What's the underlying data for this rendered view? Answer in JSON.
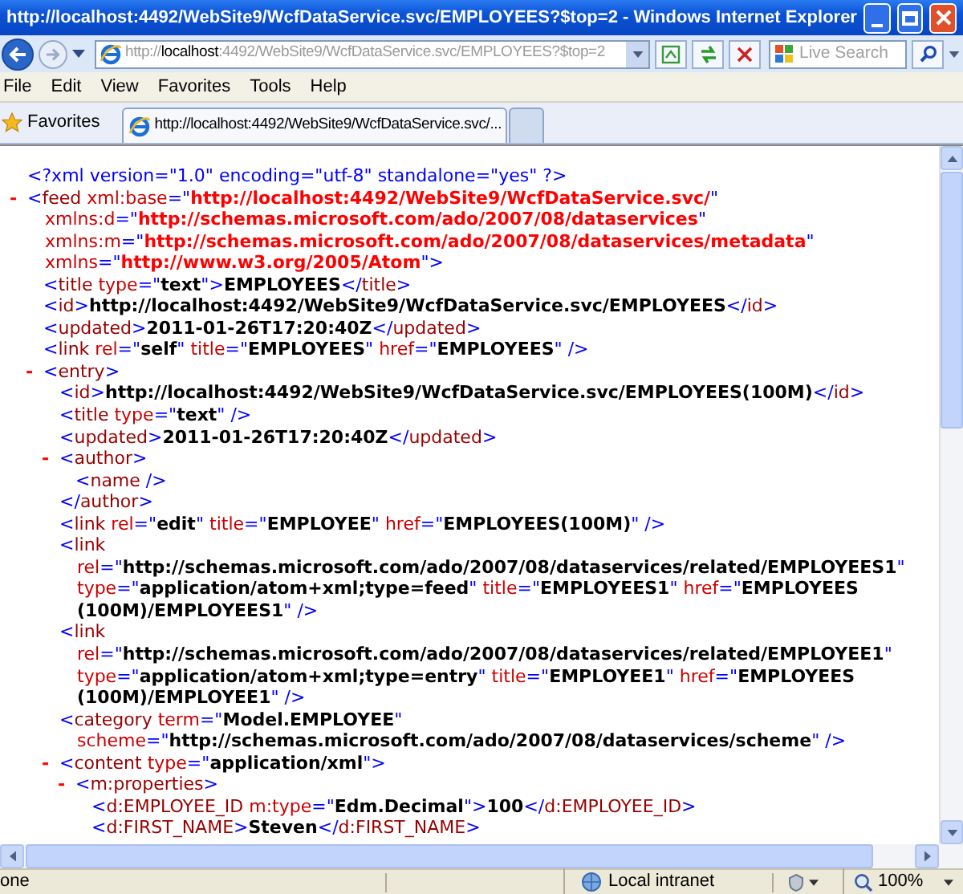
{
  "window": {
    "title": "http://localhost:4492/WebSite9/WcfDataService.svc/EMPLOYEES?$top=2 - Windows Internet Explorer"
  },
  "nav": {
    "address": {
      "scheme": "http://",
      "host": "localhost",
      "rest": ":4492/WebSite9/WcfDataService.svc/EMPLOYEES?$top=2"
    },
    "search": {
      "placeholder": "Live Search"
    }
  },
  "menu": [
    "File",
    "Edit",
    "View",
    "Favorites",
    "Tools",
    "Help"
  ],
  "favorites_bar": {
    "label": "Favorites",
    "tabs": [
      {
        "title": "http://localhost:4492/WebSite9/WcfDataService.svc/...",
        "selected": true
      }
    ]
  },
  "document": [
    {
      "lines": [
        [
          {
            "kind": "decl",
            "text": "<?xml version=\"1.0\" encoding=\"utf-8\" standalone=\"yes\" ?>"
          }
        ]
      ]
    },
    {
      "toggle": "-",
      "lines": [
        [
          {
            "kind": "punct",
            "text": "<"
          },
          {
            "kind": "tag",
            "text": "feed"
          },
          {
            "kind": "attr",
            "text": " xml:base"
          },
          {
            "kind": "punct",
            "text": "=\""
          },
          {
            "kind": "url",
            "text": "http://localhost:4492/WebSite9/WcfDataService.svc/"
          },
          {
            "kind": "punct",
            "text": "\""
          }
        ],
        [
          {
            "kind": "attr",
            "text": "xmlns:d"
          },
          {
            "kind": "punct",
            "text": "=\""
          },
          {
            "kind": "url",
            "text": "http://schemas.microsoft.com/ado/2007/08/dataservices"
          },
          {
            "kind": "punct",
            "text": "\""
          }
        ],
        [
          {
            "kind": "attr",
            "text": "xmlns:m"
          },
          {
            "kind": "punct",
            "text": "=\""
          },
          {
            "kind": "url",
            "text": "http://schemas.microsoft.com/ado/2007/08/dataservices/metadata"
          },
          {
            "kind": "punct",
            "text": "\""
          }
        ],
        [
          {
            "kind": "attr",
            "text": "xmlns"
          },
          {
            "kind": "punct",
            "text": "=\""
          },
          {
            "kind": "url",
            "text": "http://www.w3.org/2005/Atom"
          },
          {
            "kind": "punct",
            "text": "\">"
          }
        ]
      ],
      "children": [
        {
          "lines": [
            [
              {
                "kind": "punct",
                "text": "<"
              },
              {
                "kind": "tag",
                "text": "title"
              },
              {
                "kind": "attr",
                "text": " type"
              },
              {
                "kind": "punct",
                "text": "=\""
              },
              {
                "kind": "value",
                "text": "text"
              },
              {
                "kind": "punct",
                "text": "\">"
              },
              {
                "kind": "content",
                "text": "EMPLOYEES"
              },
              {
                "kind": "punct",
                "text": "</"
              },
              {
                "kind": "tag",
                "text": "title"
              },
              {
                "kind": "punct",
                "text": ">"
              }
            ]
          ]
        },
        {
          "lines": [
            [
              {
                "kind": "punct",
                "text": "<"
              },
              {
                "kind": "tag",
                "text": "id"
              },
              {
                "kind": "punct",
                "text": ">"
              },
              {
                "kind": "content",
                "text": "http://localhost:4492/WebSite9/WcfDataService.svc/EMPLOYEES"
              },
              {
                "kind": "punct",
                "text": "</"
              },
              {
                "kind": "tag",
                "text": "id"
              },
              {
                "kind": "punct",
                "text": ">"
              }
            ]
          ]
        },
        {
          "lines": [
            [
              {
                "kind": "punct",
                "text": "<"
              },
              {
                "kind": "tag",
                "text": "updated"
              },
              {
                "kind": "punct",
                "text": ">"
              },
              {
                "kind": "content",
                "text": "2011-01-26T17:20:40Z"
              },
              {
                "kind": "punct",
                "text": "</"
              },
              {
                "kind": "tag",
                "text": "updated"
              },
              {
                "kind": "punct",
                "text": ">"
              }
            ]
          ]
        },
        {
          "lines": [
            [
              {
                "kind": "punct",
                "text": "<"
              },
              {
                "kind": "tag",
                "text": "link"
              },
              {
                "kind": "attr",
                "text": " rel"
              },
              {
                "kind": "punct",
                "text": "=\""
              },
              {
                "kind": "value",
                "text": "self"
              },
              {
                "kind": "punct",
                "text": "\""
              },
              {
                "kind": "attr",
                "text": " title"
              },
              {
                "kind": "punct",
                "text": "=\""
              },
              {
                "kind": "value",
                "text": "EMPLOYEES"
              },
              {
                "kind": "punct",
                "text": "\""
              },
              {
                "kind": "attr",
                "text": " href"
              },
              {
                "kind": "punct",
                "text": "=\""
              },
              {
                "kind": "value",
                "text": "EMPLOYEES"
              },
              {
                "kind": "punct",
                "text": "\" />"
              }
            ]
          ]
        },
        {
          "toggle": "-",
          "lines": [
            [
              {
                "kind": "punct",
                "text": "<"
              },
              {
                "kind": "tag",
                "text": "entry"
              },
              {
                "kind": "punct",
                "text": ">"
              }
            ]
          ],
          "children": [
            {
              "lines": [
                [
                  {
                    "kind": "punct",
                    "text": "<"
                  },
                  {
                    "kind": "tag",
                    "text": "id"
                  },
                  {
                    "kind": "punct",
                    "text": ">"
                  },
                  {
                    "kind": "content",
                    "text": "http://localhost:4492/WebSite9/WcfDataService.svc/EMPLOYEES(100M)"
                  },
                  {
                    "kind": "punct",
                    "text": "</"
                  },
                  {
                    "kind": "tag",
                    "text": "id"
                  },
                  {
                    "kind": "punct",
                    "text": ">"
                  }
                ]
              ]
            },
            {
              "lines": [
                [
                  {
                    "kind": "punct",
                    "text": "<"
                  },
                  {
                    "kind": "tag",
                    "text": "title"
                  },
                  {
                    "kind": "attr",
                    "text": " type"
                  },
                  {
                    "kind": "punct",
                    "text": "=\""
                  },
                  {
                    "kind": "value",
                    "text": "text"
                  },
                  {
                    "kind": "punct",
                    "text": "\" />"
                  }
                ]
              ]
            },
            {
              "lines": [
                [
                  {
                    "kind": "punct",
                    "text": "<"
                  },
                  {
                    "kind": "tag",
                    "text": "updated"
                  },
                  {
                    "kind": "punct",
                    "text": ">"
                  },
                  {
                    "kind": "content",
                    "text": "2011-01-26T17:20:40Z"
                  },
                  {
                    "kind": "punct",
                    "text": "</"
                  },
                  {
                    "kind": "tag",
                    "text": "updated"
                  },
                  {
                    "kind": "punct",
                    "text": ">"
                  }
                ]
              ]
            },
            {
              "toggle": "-",
              "lines": [
                [
                  {
                    "kind": "punct",
                    "text": "<"
                  },
                  {
                    "kind": "tag",
                    "text": "author"
                  },
                  {
                    "kind": "punct",
                    "text": ">"
                  }
                ]
              ],
              "children": [
                {
                  "lines": [
                    [
                      {
                        "kind": "punct",
                        "text": "<"
                      },
                      {
                        "kind": "tag",
                        "text": "name"
                      },
                      {
                        "kind": "punct",
                        "text": " />"
                      }
                    ]
                  ]
                }
              ],
              "end": [
                [
                  {
                    "kind": "punct",
                    "text": "</"
                  },
                  {
                    "kind": "tag",
                    "text": "author"
                  },
                  {
                    "kind": "punct",
                    "text": ">"
                  }
                ]
              ]
            },
            {
              "lines": [
                [
                  {
                    "kind": "punct",
                    "text": "<"
                  },
                  {
                    "kind": "tag",
                    "text": "link"
                  },
                  {
                    "kind": "attr",
                    "text": " rel"
                  },
                  {
                    "kind": "punct",
                    "text": "=\""
                  },
                  {
                    "kind": "value",
                    "text": "edit"
                  },
                  {
                    "kind": "punct",
                    "text": "\""
                  },
                  {
                    "kind": "attr",
                    "text": " title"
                  },
                  {
                    "kind": "punct",
                    "text": "=\""
                  },
                  {
                    "kind": "value",
                    "text": "EMPLOYEE"
                  },
                  {
                    "kind": "punct",
                    "text": "\""
                  },
                  {
                    "kind": "attr",
                    "text": " href"
                  },
                  {
                    "kind": "punct",
                    "text": "=\""
                  },
                  {
                    "kind": "value",
                    "text": "EMPLOYEES(100M)"
                  },
                  {
                    "kind": "punct",
                    "text": "\" />"
                  }
                ]
              ]
            },
            {
              "lines": [
                [
                  {
                    "kind": "punct",
                    "text": "<"
                  },
                  {
                    "kind": "tag",
                    "text": "link"
                  }
                ],
                [
                  {
                    "kind": "attr",
                    "text": "rel"
                  },
                  {
                    "kind": "punct",
                    "text": "=\""
                  },
                  {
                    "kind": "value",
                    "text": "http://schemas.microsoft.com/ado/2007/08/dataservices/related/EMPLOYEES1"
                  },
                  {
                    "kind": "punct",
                    "text": "\""
                  }
                ],
                [
                  {
                    "kind": "attr",
                    "text": "type"
                  },
                  {
                    "kind": "punct",
                    "text": "=\""
                  },
                  {
                    "kind": "value",
                    "text": "application/atom+xml;type=feed"
                  },
                  {
                    "kind": "punct",
                    "text": "\""
                  },
                  {
                    "kind": "attr",
                    "text": " title"
                  },
                  {
                    "kind": "punct",
                    "text": "=\""
                  },
                  {
                    "kind": "value",
                    "text": "EMPLOYEES1"
                  },
                  {
                    "kind": "punct",
                    "text": "\""
                  },
                  {
                    "kind": "attr",
                    "text": " href"
                  },
                  {
                    "kind": "punct",
                    "text": "=\""
                  },
                  {
                    "kind": "value",
                    "text": "EMPLOYEES"
                  }
                ],
                [
                  {
                    "kind": "value",
                    "text": "(100M)/EMPLOYEES1"
                  },
                  {
                    "kind": "punct",
                    "text": "\" />"
                  }
                ]
              ]
            },
            {
              "lines": [
                [
                  {
                    "kind": "punct",
                    "text": "<"
                  },
                  {
                    "kind": "tag",
                    "text": "link"
                  }
                ],
                [
                  {
                    "kind": "attr",
                    "text": "rel"
                  },
                  {
                    "kind": "punct",
                    "text": "=\""
                  },
                  {
                    "kind": "value",
                    "text": "http://schemas.microsoft.com/ado/2007/08/dataservices/related/EMPLOYEE1"
                  },
                  {
                    "kind": "punct",
                    "text": "\""
                  }
                ],
                [
                  {
                    "kind": "attr",
                    "text": "type"
                  },
                  {
                    "kind": "punct",
                    "text": "=\""
                  },
                  {
                    "kind": "value",
                    "text": "application/atom+xml;type=entry"
                  },
                  {
                    "kind": "punct",
                    "text": "\""
                  },
                  {
                    "kind": "attr",
                    "text": " title"
                  },
                  {
                    "kind": "punct",
                    "text": "=\""
                  },
                  {
                    "kind": "value",
                    "text": "EMPLOYEE1"
                  },
                  {
                    "kind": "punct",
                    "text": "\""
                  },
                  {
                    "kind": "attr",
                    "text": " href"
                  },
                  {
                    "kind": "punct",
                    "text": "=\""
                  },
                  {
                    "kind": "value",
                    "text": "EMPLOYEES"
                  }
                ],
                [
                  {
                    "kind": "value",
                    "text": "(100M)/EMPLOYEE1"
                  },
                  {
                    "kind": "punct",
                    "text": "\" />"
                  }
                ]
              ]
            },
            {
              "lines": [
                [
                  {
                    "kind": "punct",
                    "text": "<"
                  },
                  {
                    "kind": "tag",
                    "text": "category"
                  },
                  {
                    "kind": "attr",
                    "text": " term"
                  },
                  {
                    "kind": "punct",
                    "text": "=\""
                  },
                  {
                    "kind": "value",
                    "text": "Model.EMPLOYEE"
                  },
                  {
                    "kind": "punct",
                    "text": "\""
                  }
                ],
                [
                  {
                    "kind": "attr",
                    "text": "scheme"
                  },
                  {
                    "kind": "punct",
                    "text": "=\""
                  },
                  {
                    "kind": "value",
                    "text": "http://schemas.microsoft.com/ado/2007/08/dataservices/scheme"
                  },
                  {
                    "kind": "punct",
                    "text": "\" />"
                  }
                ]
              ]
            },
            {
              "toggle": "-",
              "lines": [
                [
                  {
                    "kind": "punct",
                    "text": "<"
                  },
                  {
                    "kind": "tag",
                    "text": "content"
                  },
                  {
                    "kind": "attr",
                    "text": " type"
                  },
                  {
                    "kind": "punct",
                    "text": "=\""
                  },
                  {
                    "kind": "value",
                    "text": "application/xml"
                  },
                  {
                    "kind": "punct",
                    "text": "\">"
                  }
                ]
              ],
              "children": [
                {
                  "toggle": "-",
                  "lines": [
                    [
                      {
                        "kind": "punct",
                        "text": "<"
                      },
                      {
                        "kind": "tag",
                        "text": "m:properties"
                      },
                      {
                        "kind": "punct",
                        "text": ">"
                      }
                    ]
                  ],
                  "children": [
                    {
                      "lines": [
                        [
                          {
                            "kind": "punct",
                            "text": "<"
                          },
                          {
                            "kind": "tag",
                            "text": "d:EMPLOYEE_ID"
                          },
                          {
                            "kind": "attr",
                            "text": " m:type"
                          },
                          {
                            "kind": "punct",
                            "text": "=\""
                          },
                          {
                            "kind": "value",
                            "text": "Edm.Decimal"
                          },
                          {
                            "kind": "punct",
                            "text": "\">"
                          },
                          {
                            "kind": "content",
                            "text": "100"
                          },
                          {
                            "kind": "punct",
                            "text": "</"
                          },
                          {
                            "kind": "tag",
                            "text": "d:EMPLOYEE_ID"
                          },
                          {
                            "kind": "punct",
                            "text": ">"
                          }
                        ]
                      ]
                    },
                    {
                      "lines": [
                        [
                          {
                            "kind": "punct",
                            "text": "<"
                          },
                          {
                            "kind": "tag",
                            "text": "d:FIRST_NAME"
                          },
                          {
                            "kind": "punct",
                            "text": ">"
                          },
                          {
                            "kind": "content",
                            "text": "Steven"
                          },
                          {
                            "kind": "punct",
                            "text": "</"
                          },
                          {
                            "kind": "tag",
                            "text": "d:FIRST_NAME"
                          },
                          {
                            "kind": "punct",
                            "text": ">"
                          }
                        ]
                      ]
                    }
                  ]
                }
              ]
            }
          ]
        }
      ]
    }
  ],
  "status_bar": {
    "text": "one",
    "zone": "Local intranet",
    "zoom": "100%"
  }
}
